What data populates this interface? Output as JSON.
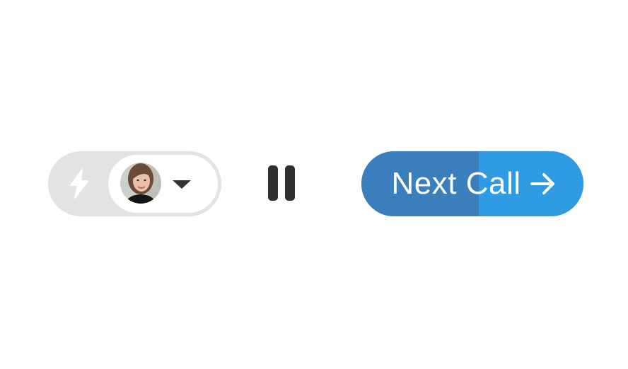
{
  "user_pill": {
    "bolt_icon": "lightning-bolt-icon",
    "avatar_icon": "user-avatar",
    "caret_icon": "caret-down-icon"
  },
  "pause": {
    "icon": "pause-icon"
  },
  "next_call": {
    "label": "Next Call",
    "arrow_icon": "arrow-right-icon",
    "progress_fraction": 0.53
  },
  "colors": {
    "pill_gray": "#e3e3e3",
    "bolt_white": "#ffffff",
    "pause_dark": "#2f2f2f",
    "next_call_dark": "#3a7fbc",
    "next_call_light": "#2f9be2",
    "caret": "#333333"
  }
}
